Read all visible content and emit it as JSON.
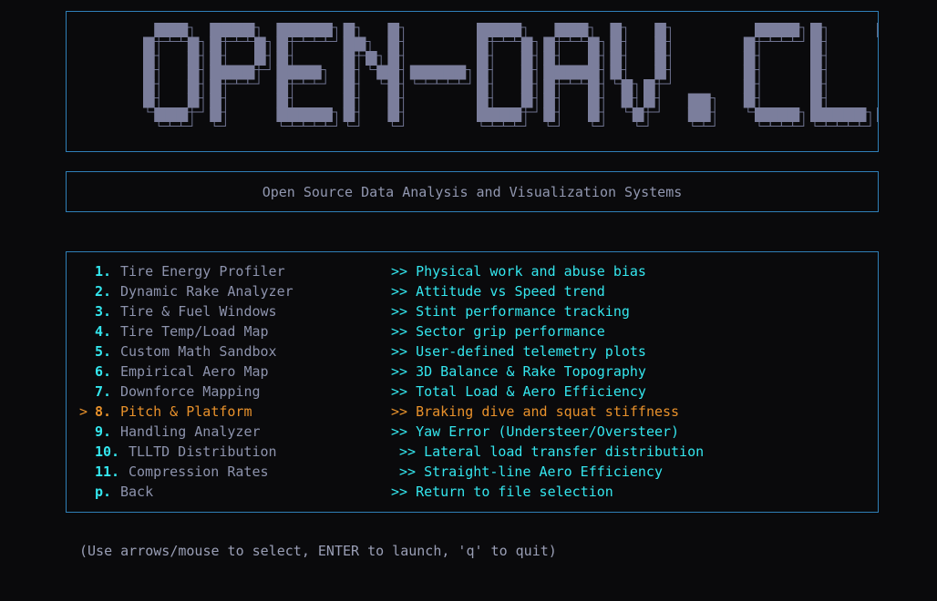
{
  "app": {
    "banner_text": "OPEN-DAV.CLI",
    "subtitle": "Open Source Data Analysis and Visualization Systems"
  },
  "menu": {
    "selected_index": 7,
    "cursor_symbol": ">",
    "items": [
      {
        "key": "1.",
        "label": "Tire Energy Profiler",
        "description": ">> Physical work and abuse bias"
      },
      {
        "key": "2.",
        "label": "Dynamic Rake Analyzer",
        "description": ">> Attitude vs Speed trend"
      },
      {
        "key": "3.",
        "label": "Tire & Fuel Windows",
        "description": ">> Stint performance tracking"
      },
      {
        "key": "4.",
        "label": "Tire Temp/Load Map",
        "description": ">> Sector grip performance"
      },
      {
        "key": "5.",
        "label": "Custom Math Sandbox",
        "description": ">> User-defined telemetry plots"
      },
      {
        "key": "6.",
        "label": "Empirical Aero Map",
        "description": ">> 3D Balance & Rake Topography"
      },
      {
        "key": "7.",
        "label": "Downforce Mapping",
        "description": ">> Total Load & Aero Efficiency"
      },
      {
        "key": "8.",
        "label": "Pitch & Platform",
        "description": ">> Braking dive and squat stiffness"
      },
      {
        "key": "9.",
        "label": "Handling Analyzer",
        "description": ">> Yaw Error (Understeer/Oversteer)"
      },
      {
        "key": "10.",
        "label": "TLLTD Distribution",
        "description": ">> Lateral load transfer distribution"
      },
      {
        "key": "11.",
        "label": "Compression Rates",
        "description": ">> Straight-line Aero Efficiency"
      },
      {
        "key": "p.",
        "label": "Back",
        "description": ">> Return to file selection"
      }
    ]
  },
  "footer": {
    "hint": "(Use arrows/mouse to select, ENTER to launch, 'q' to quit)"
  },
  "colors": {
    "border": "#2f7fb8",
    "accent_cyan": "#34e6ee",
    "selected_orange": "#e8912b",
    "banner_fill": "#7b7e9c"
  }
}
